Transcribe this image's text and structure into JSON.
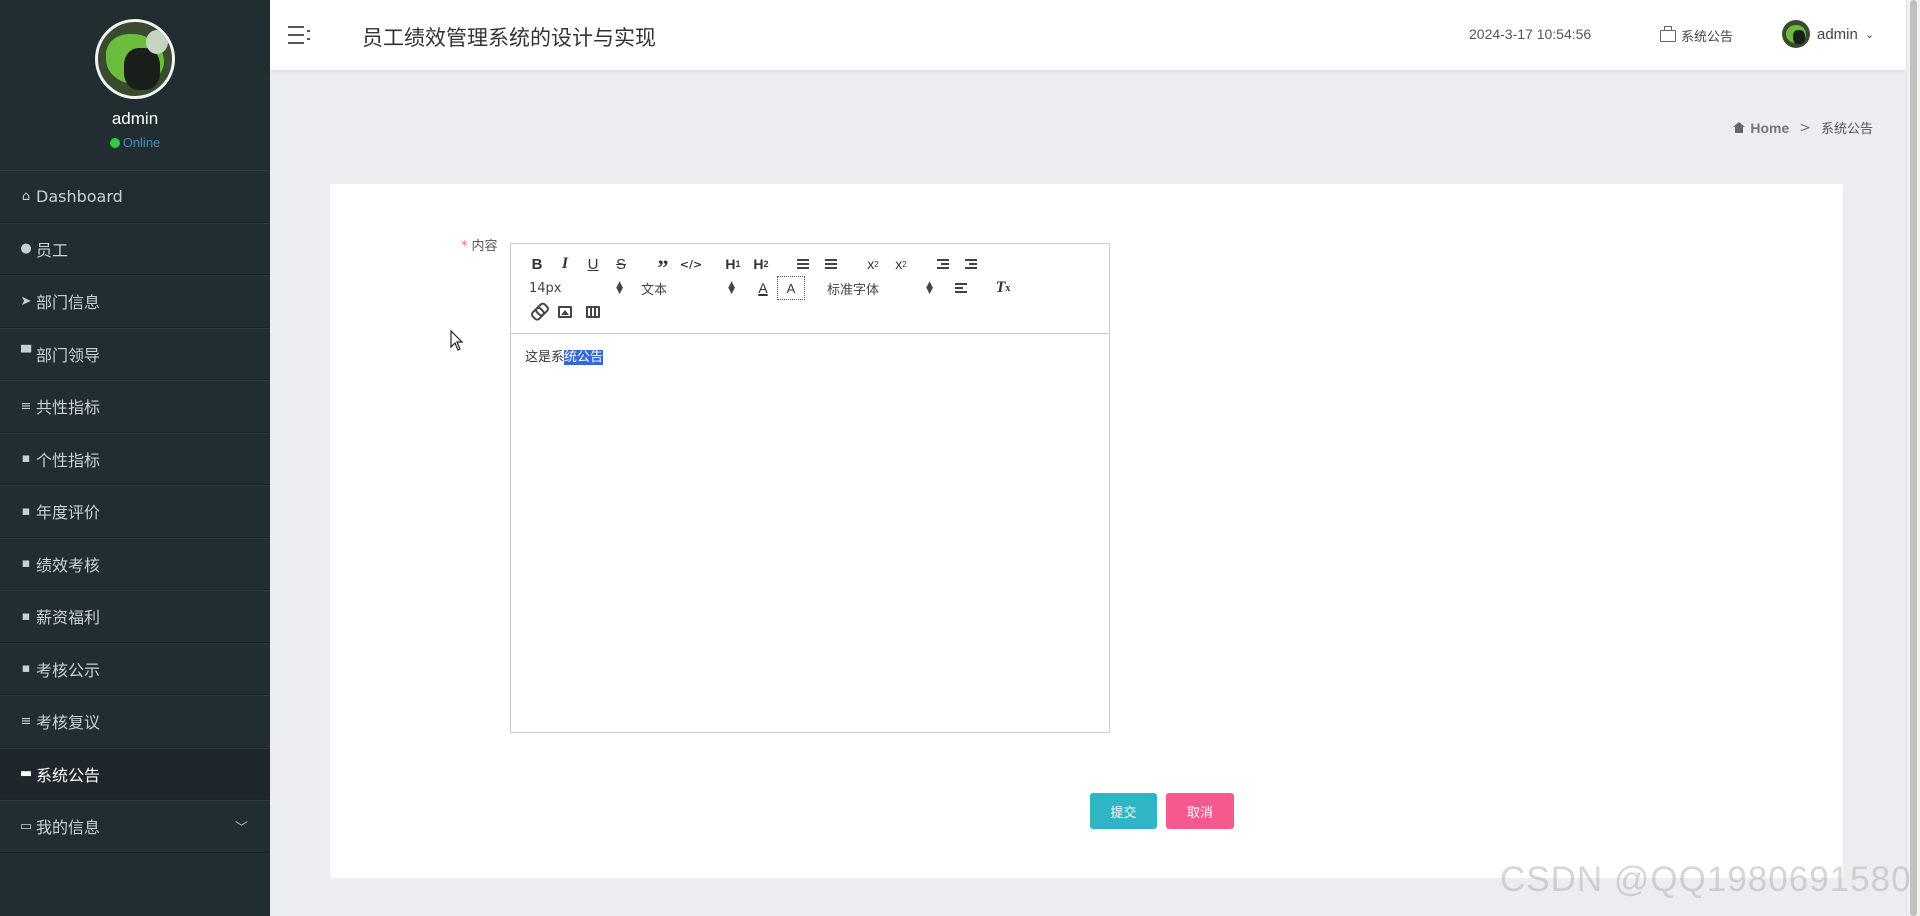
{
  "app": {
    "title": "员工绩效管理系统的设计与实现",
    "datetime": "2024-3-17 10:54:56"
  },
  "header": {
    "notice_label": "系统公告",
    "user_name": "admin"
  },
  "profile": {
    "name": "admin",
    "status": "Online"
  },
  "sidebar": {
    "items": [
      {
        "label": "Dashboard",
        "icon": "home-icon"
      },
      {
        "label": "员工",
        "icon": "pin-icon"
      },
      {
        "label": "部门信息",
        "icon": "send-icon"
      },
      {
        "label": "部门领导",
        "icon": "monitor-icon"
      },
      {
        "label": "共性指标",
        "icon": "list-icon"
      },
      {
        "label": "个性指标",
        "icon": "grid-icon"
      },
      {
        "label": "年度评价",
        "icon": "grid-icon"
      },
      {
        "label": "绩效考核",
        "icon": "grid-icon"
      },
      {
        "label": "薪资福利",
        "icon": "grid-icon"
      },
      {
        "label": "考核公示",
        "icon": "grid-icon"
      },
      {
        "label": "考核复议",
        "icon": "list-icon"
      },
      {
        "label": "系统公告",
        "icon": "ticket-icon",
        "active": true
      },
      {
        "label": "我的信息",
        "icon": "card-icon",
        "expandable": true
      }
    ]
  },
  "breadcrumb": {
    "home": "Home",
    "separator": ">",
    "current": "系统公告"
  },
  "form": {
    "content_label": "内容",
    "required_mark": "*",
    "editor": {
      "font_size": "14px",
      "header_select": "文本",
      "font_family": "标准字体",
      "text_before": "这是系",
      "text_selected": "统公告"
    },
    "submit_label": "提交",
    "cancel_label": "取消"
  },
  "watermark": "CSDN @QQ1980691580",
  "colors": {
    "sidebar_bg": "#222d32",
    "submit": "#2fb5c4",
    "cancel": "#f7588d",
    "selection": "#3367d6",
    "online": "#2ecc40"
  }
}
